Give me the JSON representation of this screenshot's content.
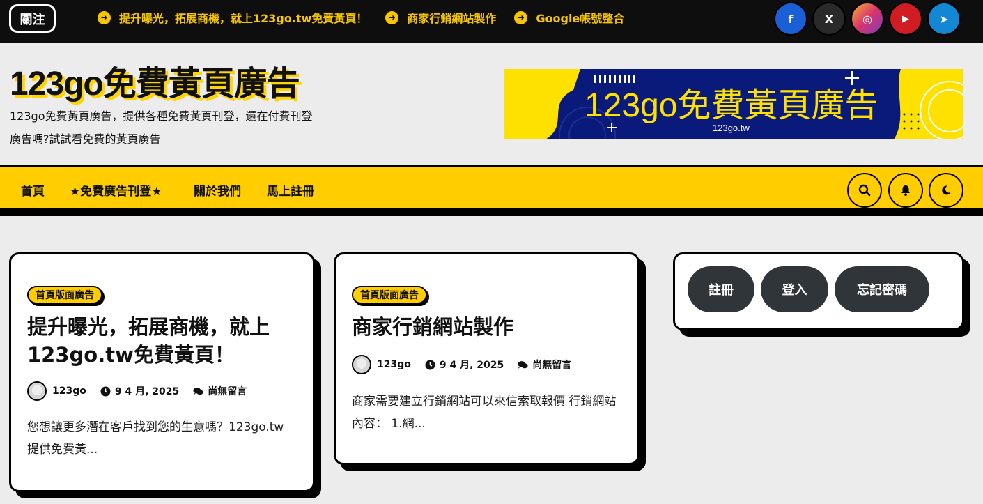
{
  "topbar": {
    "follow_label": "關注",
    "ticker": [
      "提升曝光，拓展商機，就上123go.tw免費黃頁！",
      "商家行銷網站製作",
      "Google帳號整合"
    ],
    "socials": [
      {
        "icon": "facebook-icon",
        "glyph": "f",
        "color": "#1a5fd6"
      },
      {
        "icon": "x-icon",
        "glyph": "X",
        "color": "#2a2a2a"
      },
      {
        "icon": "instagram-icon",
        "glyph": "◎",
        "color": "#d6336c"
      },
      {
        "icon": "youtube-icon",
        "glyph": "▶",
        "color": "#d01c22"
      },
      {
        "icon": "telegram-icon",
        "glyph": "➤",
        "color": "#1387d4"
      }
    ]
  },
  "header": {
    "site_title": "123go免費黃頁廣告",
    "site_description": "123go免費黃頁廣告，提供各種免費黃頁刊登，還在付費刊登廣告嗎?試試看免費的黃頁廣告",
    "banner": {
      "title": "123go免費黃頁廣告",
      "url_text": "123go.tw"
    }
  },
  "nav": {
    "items": [
      "首頁",
      "★免費廣告刊登★",
      "關於我們",
      "馬上註冊"
    ]
  },
  "posts": [
    {
      "category": "首頁版面廣告",
      "title": "提升曝光，拓展商機，就上123go.tw免費黃頁！",
      "author": "123go",
      "date": "9 4 月, 2025",
      "comments": "尚無留言",
      "excerpt": "您想讓更多潛在客戶找到您的生意嗎？123go.tw提供免費黃..."
    },
    {
      "category": "首頁版面廣告",
      "title": "商家行銷網站製作",
      "author": "123go",
      "date": "9 4 月, 2025",
      "comments": "尚無留言",
      "excerpt": "商家需要建立行銷網站可以來信索取報價 行銷網站內容： 1.網..."
    }
  ],
  "sidebar": {
    "register_label": "註冊",
    "login_label": "登入",
    "forgot_label": "忘記密碼"
  },
  "colors": {
    "accent": "#ffcd00",
    "topbar_bg": "#0e0e0e",
    "banner_blue": "#0a1a7a"
  }
}
